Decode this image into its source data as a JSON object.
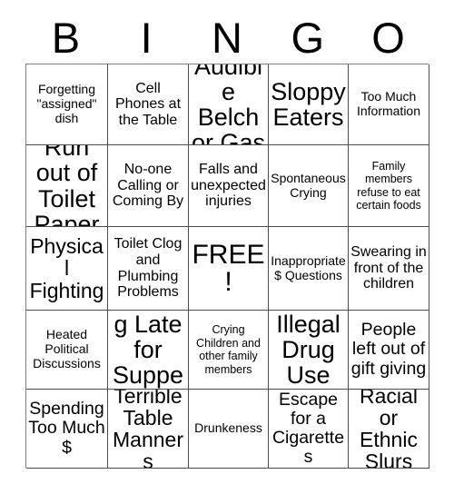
{
  "card": {
    "title_letters": [
      "B",
      "I",
      "N",
      "G",
      "O"
    ],
    "grid_size": "5x5",
    "free_space_index": 12,
    "colors": {
      "background": "#ffffff",
      "text": "#000000",
      "grid_line": "#4d4d4d"
    }
  },
  "squares": [
    {
      "text": "Forgetting \"assigned\" dish",
      "size": "s"
    },
    {
      "text": "Cell Phones at the Table",
      "size": "m"
    },
    {
      "text": "Audible Belch or Gas",
      "size": "xxl"
    },
    {
      "text": "Sloppy Eaters",
      "size": "xxl"
    },
    {
      "text": "Too Much Information",
      "size": "s"
    },
    {
      "text": "Run out of Toilet Paper",
      "size": "xxl"
    },
    {
      "text": "No-one Calling or Coming By",
      "size": "m"
    },
    {
      "text": "Falls and unexpected injuries",
      "size": "m"
    },
    {
      "text": "Spontaneous Crying",
      "size": "s"
    },
    {
      "text": "Family members refuse to eat certain foods",
      "size": "xs"
    },
    {
      "text": "Physical Fighting",
      "size": "xl"
    },
    {
      "text": "Toilet Clog and Plumbing Problems",
      "size": "m"
    },
    {
      "text": "FREE!",
      "size": "free"
    },
    {
      "text": "Inappropriate $ Questions",
      "size": "s"
    },
    {
      "text": "Swearing in front of the children",
      "size": "m"
    },
    {
      "text": "Heated Political Discussions",
      "size": "s"
    },
    {
      "text": "Arriving Late for Supper",
      "size": "xxl"
    },
    {
      "text": "Crying Children and other family members",
      "size": "xs"
    },
    {
      "text": "Illegal Drug Use",
      "size": "xxl"
    },
    {
      "text": "People left out of gift giving",
      "size": "l"
    },
    {
      "text": "Spending Too Much $",
      "size": "l"
    },
    {
      "text": "Terrible Table Manners",
      "size": "xl"
    },
    {
      "text": "Drunkeness",
      "size": "s"
    },
    {
      "text": "Escape for a Cigarettes",
      "size": "l"
    },
    {
      "text": "Racial or Ethnic Slurs",
      "size": "xl"
    }
  ]
}
